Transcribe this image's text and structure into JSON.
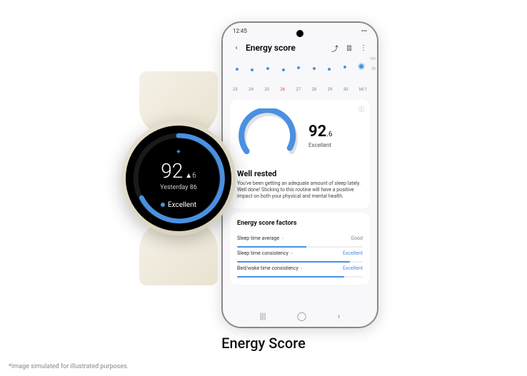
{
  "caption": "Energy Score",
  "disclaimer": "*Image simulated for illustrated purposes.",
  "watch": {
    "score": "92",
    "delta": "▲6",
    "yesterday": "Yesterday 86",
    "status": "Excellent"
  },
  "phone": {
    "time": "12:45",
    "header_title": "Energy score",
    "gauge": {
      "score_big": "92",
      "score_small": ".6",
      "label": "Excellent"
    },
    "well": {
      "title": "Well rested",
      "desc": "You've been getting an adequate amount of sleep lately. Well done! Sticking to this routine will have a positive impact on both your physical and mental health."
    },
    "factors_title": "Energy score factors",
    "factors": [
      {
        "name": "Sleep time average",
        "value": "Good",
        "cls": "good",
        "bar": 55
      },
      {
        "name": "Sleep time consistency",
        "value": "Excellent",
        "cls": "exc",
        "bar": 90
      },
      {
        "name": "Bed/wake time consistency",
        "value": "Excellent",
        "cls": "exc",
        "bar": 85
      }
    ],
    "y_max": "100",
    "y_mid": "50"
  },
  "chart_data": {
    "type": "line",
    "categories": [
      "23",
      "24",
      "25",
      "26",
      "27",
      "28",
      "29",
      "30",
      "M/1"
    ],
    "values": [
      72,
      68,
      74,
      65,
      78,
      75,
      70,
      82,
      92
    ],
    "ylim": [
      0,
      100
    ],
    "xlabel": "",
    "ylabel": ""
  }
}
